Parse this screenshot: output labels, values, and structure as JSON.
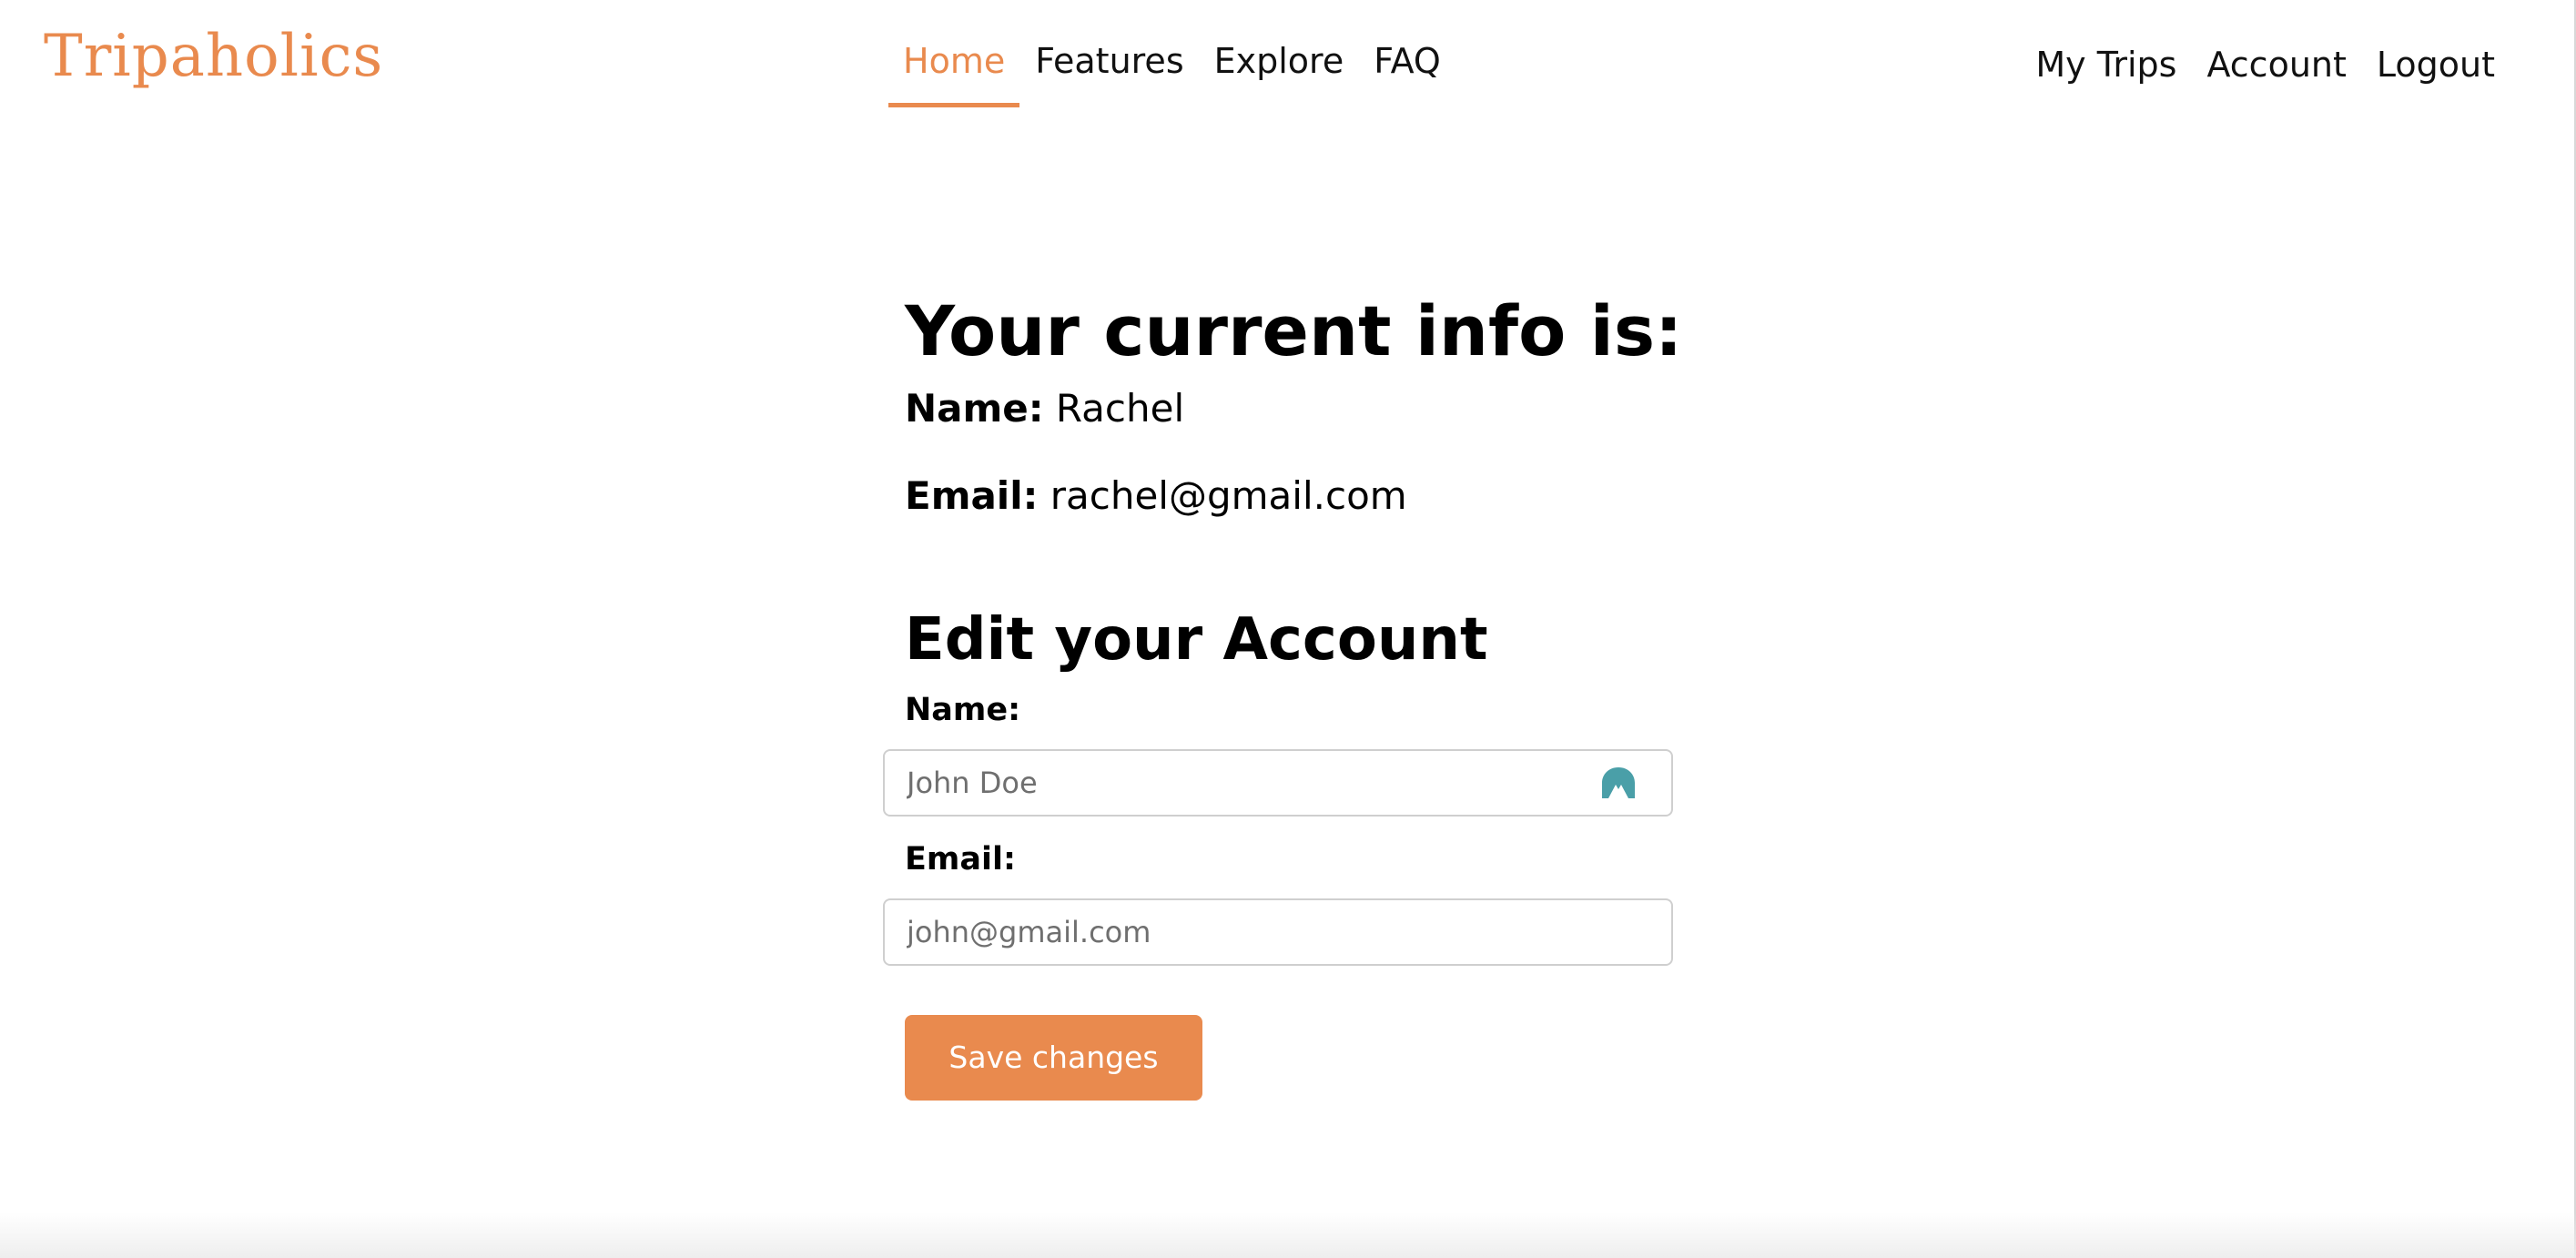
{
  "brand": {
    "name": "Tripaholics",
    "color": "#e98a4e"
  },
  "nav": {
    "center": [
      {
        "label": "Home",
        "active": true
      },
      {
        "label": "Features",
        "active": false
      },
      {
        "label": "Explore",
        "active": false
      },
      {
        "label": "FAQ",
        "active": false
      }
    ],
    "right": [
      {
        "label": "My Trips"
      },
      {
        "label": "Account"
      },
      {
        "label": "Logout"
      }
    ]
  },
  "current_info": {
    "title": "Your current info is:",
    "name_label": "Name:",
    "name_value": "Rachel",
    "email_label": "Email:",
    "email_value": "rachel@gmail.com"
  },
  "edit": {
    "title": "Edit your Account",
    "name_label": "Name:",
    "name_placeholder": "John Doe",
    "name_value": "",
    "email_label": "Email:",
    "email_placeholder": "john@gmail.com",
    "email_value": "",
    "save_label": "Save changes"
  },
  "icons": {
    "autofill": "password-manager-autofill-icon"
  },
  "colors": {
    "accent": "#e98a4e",
    "autofill_icon": "#4a9fa8",
    "text": "#000000"
  }
}
